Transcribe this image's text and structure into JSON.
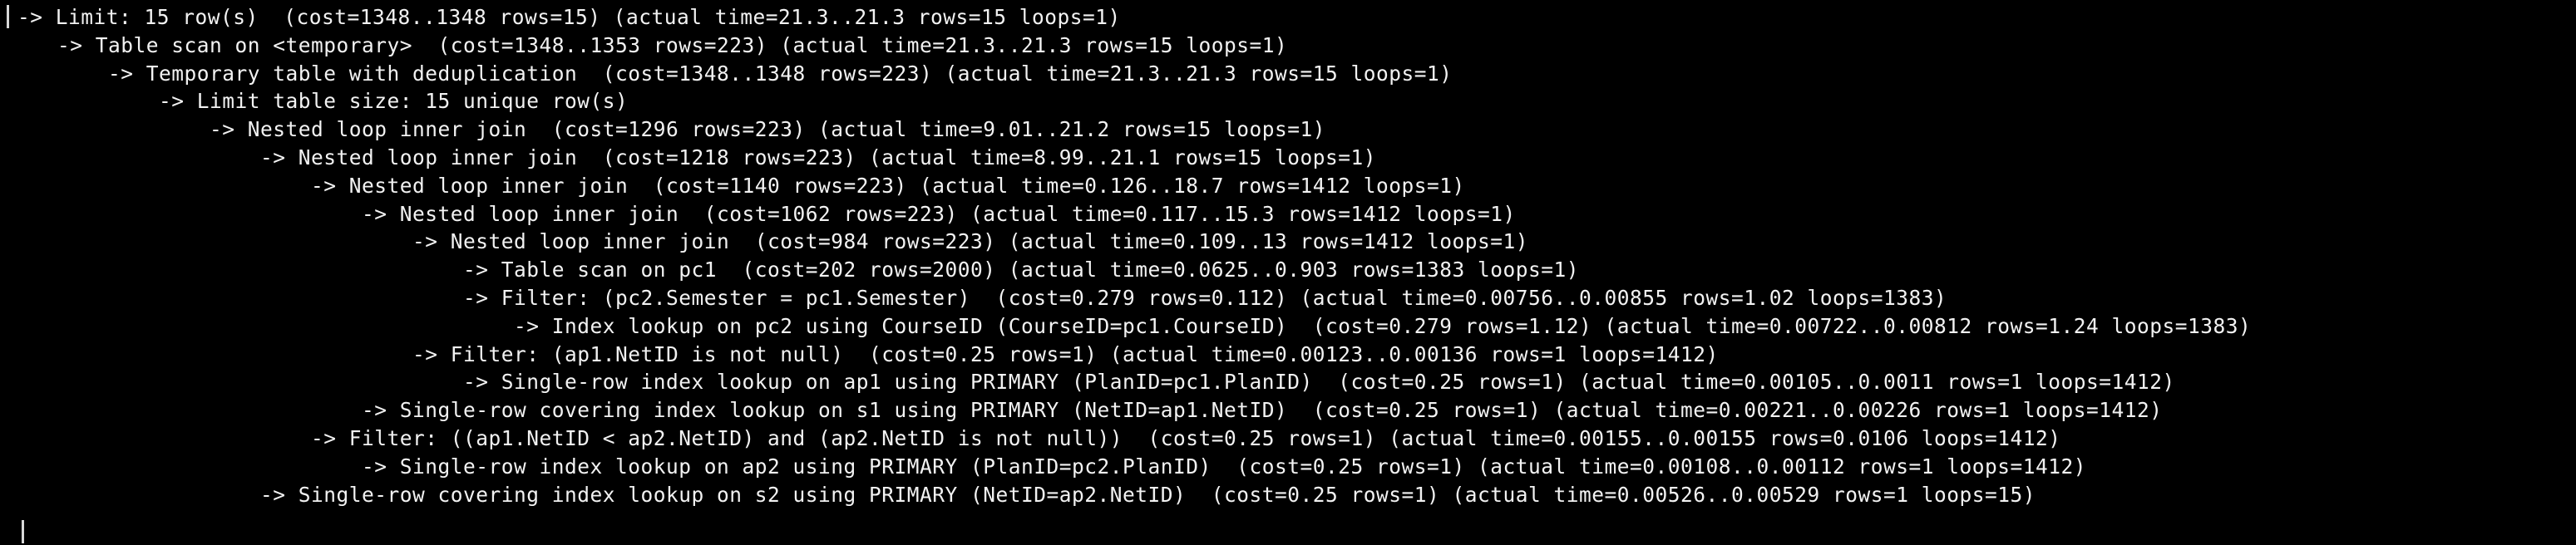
{
  "terminal": {
    "lines": [
      "-> Limit: 15 row(s)  (cost=1348..1348 rows=15) (actual time=21.3..21.3 rows=15 loops=1)",
      "    -> Table scan on <temporary>  (cost=1348..1353 rows=223) (actual time=21.3..21.3 rows=15 loops=1)",
      "        -> Temporary table with deduplication  (cost=1348..1348 rows=223) (actual time=21.3..21.3 rows=15 loops=1)",
      "            -> Limit table size: 15 unique row(s)",
      "                -> Nested loop inner join  (cost=1296 rows=223) (actual time=9.01..21.2 rows=15 loops=1)",
      "                    -> Nested loop inner join  (cost=1218 rows=223) (actual time=8.99..21.1 rows=15 loops=1)",
      "                        -> Nested loop inner join  (cost=1140 rows=223) (actual time=0.126..18.7 rows=1412 loops=1)",
      "                            -> Nested loop inner join  (cost=1062 rows=223) (actual time=0.117..15.3 rows=1412 loops=1)",
      "                                -> Nested loop inner join  (cost=984 rows=223) (actual time=0.109..13 rows=1412 loops=1)",
      "                                    -> Table scan on pc1  (cost=202 rows=2000) (actual time=0.0625..0.903 rows=1383 loops=1)",
      "                                    -> Filter: (pc2.Semester = pc1.Semester)  (cost=0.279 rows=0.112) (actual time=0.00756..0.00855 rows=1.02 loops=1383)",
      "                                        -> Index lookup on pc2 using CourseID (CourseID=pc1.CourseID)  (cost=0.279 rows=1.12) (actual time=0.00722..0.00812 rows=1.24 loops=1383)",
      "                                -> Filter: (ap1.NetID is not null)  (cost=0.25 rows=1) (actual time=0.00123..0.00136 rows=1 loops=1412)",
      "                                    -> Single-row index lookup on ap1 using PRIMARY (PlanID=pc1.PlanID)  (cost=0.25 rows=1) (actual time=0.00105..0.0011 rows=1 loops=1412)",
      "                            -> Single-row covering index lookup on s1 using PRIMARY (NetID=ap1.NetID)  (cost=0.25 rows=1) (actual time=0.00221..0.00226 rows=1 loops=1412)",
      "                        -> Filter: ((ap1.NetID < ap2.NetID) and (ap2.NetID is not null))  (cost=0.25 rows=1) (actual time=0.00155..0.00155 rows=0.0106 loops=1412)",
      "                            -> Single-row index lookup on ap2 using PRIMARY (PlanID=pc2.PlanID)  (cost=0.25 rows=1) (actual time=0.00108..0.00112 rows=1 loops=1412)",
      "                    -> Single-row covering index lookup on s2 using PRIMARY (NetID=ap2.NetID)  (cost=0.25 rows=1) (actual time=0.00526..0.00529 rows=1 loops=15)"
    ]
  }
}
